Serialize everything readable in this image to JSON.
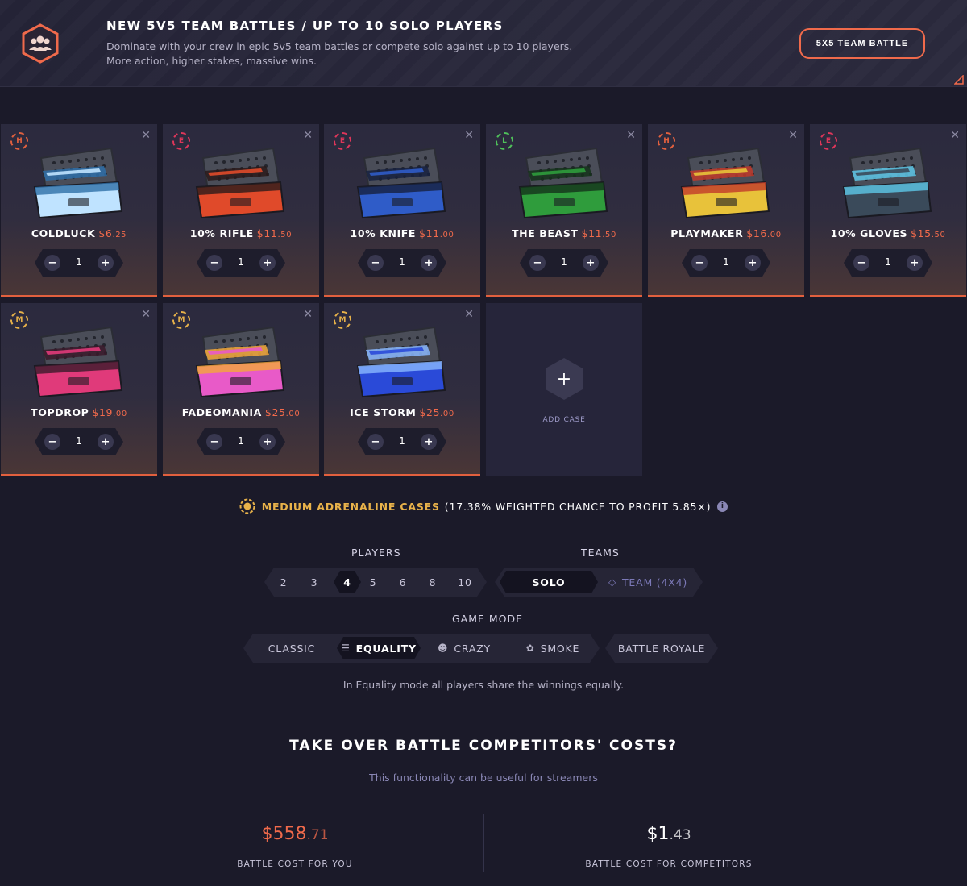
{
  "banner": {
    "title": "NEW 5V5 TEAM BATTLES / UP TO 10 SOLO PLAYERS",
    "desc_line1": "Dominate with your crew in epic 5v5 team battles or compete solo against up to 10 players.",
    "desc_line2": "More action, higher stakes, massive wins.",
    "button": "5X5 TEAM BATTLE",
    "accent": "#f06a4b"
  },
  "cases": [
    {
      "name": "COLDLUCK",
      "price": "$6",
      "cents": ".25",
      "tier": "H",
      "tier_color": "#e2603e",
      "qty": "1",
      "art_colors": [
        "#bfe3ff",
        "#2e6fa8"
      ]
    },
    {
      "name": "10% RIFLE",
      "price": "$11",
      "cents": ".50",
      "tier": "E",
      "tier_color": "#e0365a",
      "qty": "1",
      "art_colors": [
        "#e04a2a",
        "#2a1a1a"
      ]
    },
    {
      "name": "10% KNIFE",
      "price": "$11",
      "cents": ".00",
      "tier": "E",
      "tier_color": "#e0365a",
      "qty": "1",
      "art_colors": [
        "#2f5cc8",
        "#16213f"
      ]
    },
    {
      "name": "THE BEAST",
      "price": "$11",
      "cents": ".50",
      "tier": "L",
      "tier_color": "#4fc15a",
      "qty": "1",
      "art_colors": [
        "#2f9c3c",
        "#14321a"
      ]
    },
    {
      "name": "PLAYMAKER",
      "price": "$16",
      "cents": ".00",
      "tier": "H",
      "tier_color": "#e2603e",
      "qty": "1",
      "art_colors": [
        "#e8c23a",
        "#c03a2a"
      ]
    },
    {
      "name": "10% GLOVES",
      "price": "$15",
      "cents": ".50",
      "tier": "E",
      "tier_color": "#e0365a",
      "qty": "1",
      "art_colors": [
        "#3a4a5a",
        "#5ec8e8"
      ]
    },
    {
      "name": "TOPDROP",
      "price": "$19",
      "cents": ".00",
      "tier": "M",
      "tier_color": "#e8b24a",
      "qty": "1",
      "art_colors": [
        "#e03a7a",
        "#3a1a2a"
      ]
    },
    {
      "name": "FADEOMANIA",
      "price": "$25",
      "cents": ".00",
      "tier": "M",
      "tier_color": "#e8b24a",
      "qty": "1",
      "art_colors": [
        "#e85ac8",
        "#f2a83a"
      ]
    },
    {
      "name": "ICE STORM",
      "price": "$25",
      "cents": ".00",
      "tier": "M",
      "tier_color": "#e8b24a",
      "qty": "1",
      "art_colors": [
        "#2a4ad8",
        "#8ab8ff"
      ]
    }
  ],
  "add_case": {
    "label": "ADD CASE",
    "icon": "plus-icon"
  },
  "adrenaline": {
    "label": "MEDIUM ADRENALINE CASES",
    "stats": "(17.38% WEIGHTED CHANCE TO PROFIT 5.85×)",
    "info": "i",
    "color": "#e8b24a"
  },
  "players": {
    "label": "PLAYERS",
    "options": [
      "2",
      "3",
      "4",
      "5",
      "6",
      "8",
      "10"
    ],
    "selected": "4"
  },
  "teams": {
    "label": "TEAMS",
    "options": [
      "SOLO",
      "TEAM (4X4)"
    ],
    "selected": "SOLO"
  },
  "game_mode": {
    "label": "GAME MODE",
    "options": [
      {
        "label": "CLASSIC",
        "icon": ""
      },
      {
        "label": "EQUALITY",
        "icon": "equals-icon"
      },
      {
        "label": "CRAZY",
        "icon": "crazy-face-icon"
      },
      {
        "label": "SMOKE",
        "icon": "smoke-icon"
      },
      {
        "label": "BATTLE ROYALE",
        "icon": ""
      }
    ],
    "selected": "EQUALITY",
    "hint": "In Equality mode all players share the winnings equally."
  },
  "takeover": {
    "title": "TAKE OVER BATTLE COMPETITORS' COSTS?",
    "subtitle": "This functionality can be useful for streamers"
  },
  "costs": {
    "you": {
      "value": "$558",
      "cents": ".71",
      "label": "BATTLE COST FOR YOU",
      "color": "#f06a4b"
    },
    "competitors": {
      "value": "$1",
      "cents": ".43",
      "label": "BATTLE COST FOR COMPETITORS",
      "color": "#ffffff"
    }
  }
}
